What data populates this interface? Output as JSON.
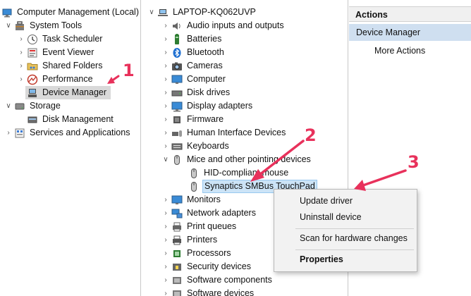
{
  "left_tree": {
    "root": "Computer Management (Local)",
    "system_tools": "System Tools",
    "task_scheduler": "Task Scheduler",
    "event_viewer": "Event Viewer",
    "shared_folders": "Shared Folders",
    "performance": "Performance",
    "device_manager": "Device Manager",
    "storage": "Storage",
    "disk_management": "Disk Management",
    "services_apps": "Services and Applications"
  },
  "device_tree": {
    "computer_name": "LAPTOP-KQ062UVP",
    "categories": {
      "audio": "Audio inputs and outputs",
      "batteries": "Batteries",
      "bluetooth": "Bluetooth",
      "cameras": "Cameras",
      "computer": "Computer",
      "disk_drives": "Disk drives",
      "display_adapters": "Display adapters",
      "firmware": "Firmware",
      "hid": "Human Interface Devices",
      "keyboards": "Keyboards",
      "mice": "Mice and other pointing devices",
      "monitors": "Monitors",
      "network": "Network adapters",
      "print_queues": "Print queues",
      "printers": "Printers",
      "processors": "Processors",
      "security": "Security devices",
      "software_components": "Software components",
      "software_devices": "Software devices"
    },
    "mice_children": {
      "hid_mouse": "HID-compliant mouse",
      "synaptics": "Synaptics SMBus TouchPad"
    }
  },
  "actions": {
    "header": "Actions",
    "section": "Device Manager",
    "more": "More Actions"
  },
  "context_menu": {
    "update_driver": "Update driver",
    "uninstall_device": "Uninstall device",
    "scan": "Scan for hardware changes",
    "properties": "Properties"
  },
  "annotations": {
    "step1": "1",
    "step2": "2",
    "step3": "3"
  },
  "colors": {
    "annotation": "#e8315b",
    "selection_blue": "#cce4f7",
    "actions_section": "#cfdff0"
  }
}
